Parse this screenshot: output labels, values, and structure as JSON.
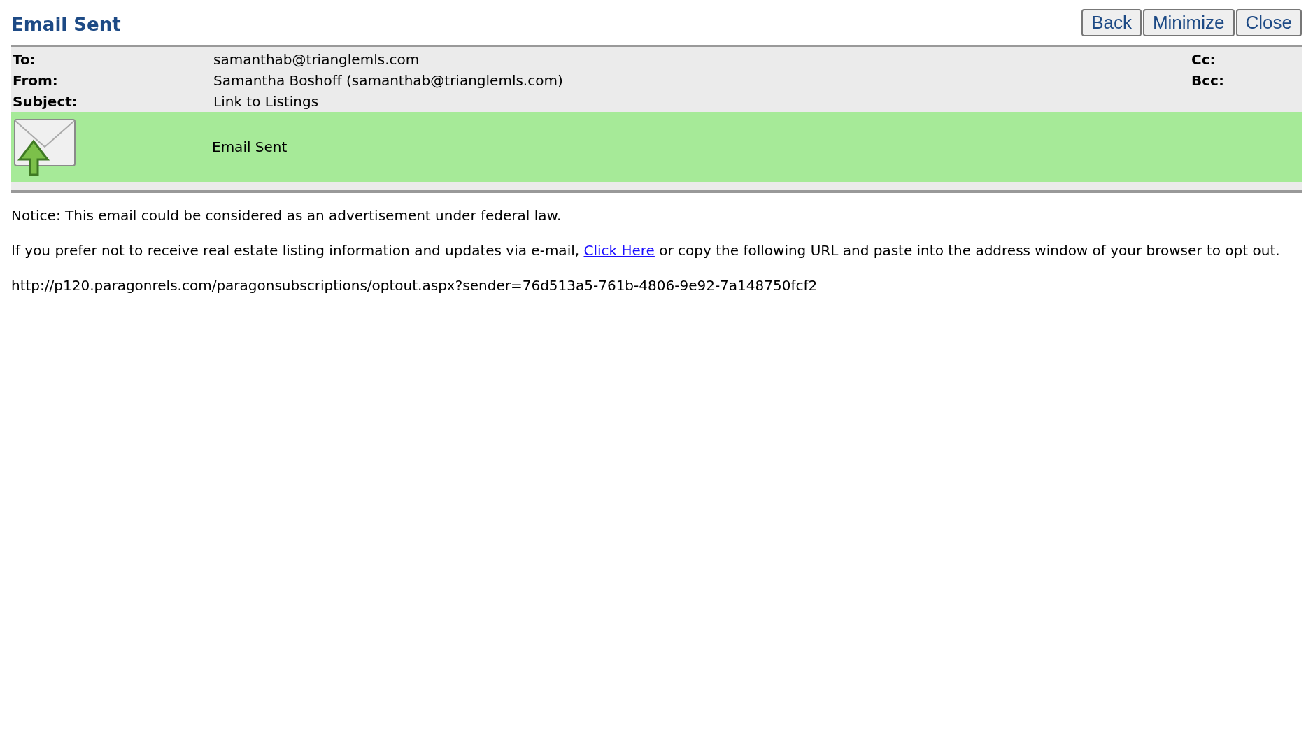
{
  "title": "Email Sent",
  "buttons": [
    "Back",
    "Minimize",
    "Close"
  ],
  "header": {
    "fields": [
      {
        "label": "To:",
        "value": "samanthab@trianglemls.com"
      },
      {
        "label": "From:",
        "value": "Samantha Boshoff (samanthab@trianglemls.com)"
      },
      {
        "label": "Subject:",
        "value": "Link to Listings"
      }
    ],
    "side_fields": [
      {
        "label": "Cc:"
      },
      {
        "label": "Bcc:"
      }
    ]
  },
  "status": {
    "message": "Email Sent"
  },
  "notice": "Notice: This email could be considered as an advertisement under federal law.",
  "optout": {
    "before": "If you prefer not to receive real estate listing information and updates via e-mail, ",
    "link": "Click Here",
    "after": " or copy the following URL and paste into the address window of your browser to opt out."
  },
  "url": "http://p120.paragonrels.com/paragonsubscriptions/optout.aspx?sender=76d513a5-761b-4806-9e92-7a148750fcf2"
}
